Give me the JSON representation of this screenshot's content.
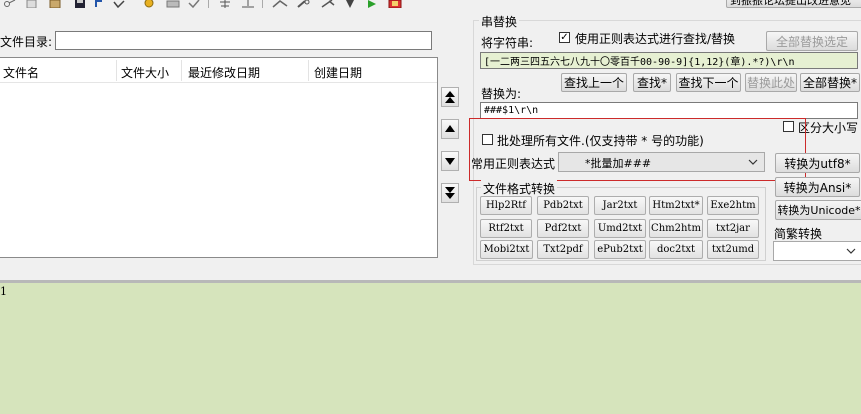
{
  "toolbar": {
    "top_right_button": "到振振论坛提出改进意见",
    "icons": [
      "scissors-icon",
      "copy-icon",
      "paste-icon",
      "save-icon",
      "undo-icon",
      "redo-icon",
      "settings-icon",
      "print-icon",
      "check-icon",
      "separator",
      "align-icon",
      "align-bottom-icon",
      "separator",
      "link-icon",
      "find-icon",
      "tools-icon",
      "play-icon",
      "exit-icon"
    ]
  },
  "file_panel": {
    "dir_label": "文件目录:",
    "dir_value": "",
    "columns": [
      "文件名",
      "文件大小",
      "最近修改日期",
      "创建日期"
    ]
  },
  "replace_panel": {
    "group_title": "串替换",
    "find_label": "将字符串:",
    "use_regex_label": "使用正则表达式进行查找/替换",
    "use_regex_checked": true,
    "replace_all_selected": "全部替换选定",
    "find_value": "[一二两三四五六七八九十〇零百千00-90-9]{1,12}(章).*?)\\r\\n",
    "find_prev": "查找上一个",
    "find_star": "查找*",
    "find_next": "查找下一个",
    "replace_here": "替换此处",
    "replace_all_star": "全部替换*",
    "replace_label": "替换为:",
    "replace_value": "###$1\\r\\n",
    "case_sensitive_label": "区分大小写",
    "batch_label": "批处理所有文件.(仅支持带 * 号的功能)",
    "common_regex_label": "常用正则表达式",
    "common_regex_value": "*批量加###"
  },
  "format_panel": {
    "title": "文件格式转换",
    "buttons": [
      [
        "Hlp2Rtf",
        "Pdb2txt",
        "Jar2txt",
        "Htm2txt*",
        "Exe2htm"
      ],
      [
        "Rtf2txt",
        "Pdf2txt",
        "Umd2txt",
        "Chm2htm",
        "txt2jar"
      ],
      [
        "Mobi2txt",
        "Txt2pdf",
        "ePub2txt",
        "doc2txt",
        "txt2umd"
      ]
    ],
    "to_utf8": "转换为utf8*",
    "to_ansi": "转换为Ansi*",
    "to_unicode": "转换为Unicode*",
    "jianfan_label": "简繁转换",
    "jianfan_value": ""
  },
  "editor": {
    "line_number": "1",
    "background": "#d6e4bc"
  },
  "colors": {
    "highlight_border": "#cc2a2a"
  }
}
